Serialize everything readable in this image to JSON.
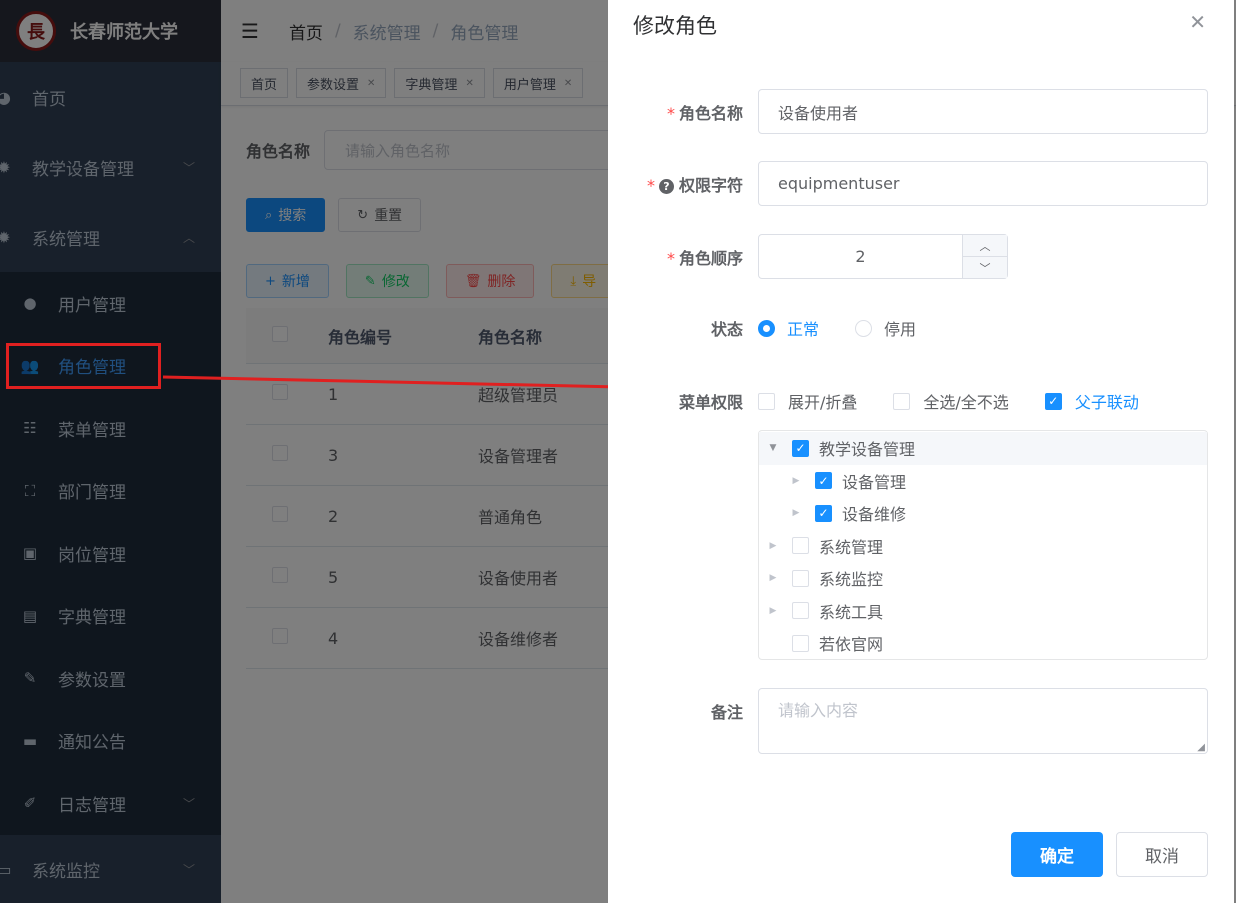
{
  "sidebar": {
    "logo_text": "长春师范大学",
    "logo_glyph": "長",
    "menus": [
      {
        "label": "首页",
        "icon": "dashboard-icon"
      },
      {
        "label": "教学设备管理",
        "icon": "gear-icon"
      },
      {
        "label": "系统管理",
        "icon": "gear-icon"
      }
    ],
    "sub_items": [
      {
        "label": "用户管理",
        "icon": "user-icon"
      },
      {
        "label": "角色管理",
        "icon": "peoples-icon"
      },
      {
        "label": "菜单管理",
        "icon": "tree-table-icon"
      },
      {
        "label": "部门管理",
        "icon": "tree-icon"
      },
      {
        "label": "岗位管理",
        "icon": "post-icon"
      },
      {
        "label": "字典管理",
        "icon": "dict-icon"
      },
      {
        "label": "参数设置",
        "icon": "edit-icon"
      },
      {
        "label": "通知公告",
        "icon": "message-icon"
      },
      {
        "label": "日志管理",
        "icon": "log-icon"
      }
    ],
    "bottom_menu": {
      "label": "系统监控",
      "icon": "monitor-icon"
    }
  },
  "breadcrumb": [
    "首页",
    "系统管理",
    "角色管理"
  ],
  "tags": [
    "首页",
    "参数设置",
    "字典管理",
    "用户管理"
  ],
  "query": {
    "label": "角色名称",
    "placeholder": "请输入角色名称",
    "search_btn": "搜索",
    "reset_btn": "重置"
  },
  "toolbar": {
    "add": "新增",
    "edit": "修改",
    "delete": "删除",
    "export": "导"
  },
  "table": {
    "headers": [
      "角色编号",
      "角色名称"
    ],
    "rows": [
      [
        "1",
        "超级管理员"
      ],
      [
        "3",
        "设备管理者"
      ],
      [
        "2",
        "普通角色"
      ],
      [
        "5",
        "设备使用者"
      ],
      [
        "4",
        "设备维修者"
      ]
    ]
  },
  "dialog": {
    "title": "修改角色",
    "role_name_label": "角色名称",
    "role_name_value": "设备使用者",
    "role_key_label": "权限字符",
    "role_key_value": "equipmentuser",
    "role_sort_label": "角色顺序",
    "role_sort_value": "2",
    "status_label": "状态",
    "status_normal": "正常",
    "status_disabled": "停用",
    "menu_label": "菜单权限",
    "expand_label": "展开/折叠",
    "select_all_label": "全选/全不选",
    "linkage_label": "父子联动",
    "tree": [
      {
        "label": "教学设备管理",
        "level": 0,
        "checked": true,
        "expanded": true
      },
      {
        "label": "设备管理",
        "level": 1,
        "checked": true
      },
      {
        "label": "设备维修",
        "level": 1,
        "checked": true
      },
      {
        "label": "系统管理",
        "level": 0,
        "checked": false
      },
      {
        "label": "系统监控",
        "level": 0,
        "checked": false
      },
      {
        "label": "系统工具",
        "level": 0,
        "checked": false
      },
      {
        "label": "若依官网",
        "level": 0,
        "checked": false
      }
    ],
    "remark_label": "备注",
    "remark_placeholder": "请输入内容",
    "ok_btn": "确定",
    "cancel_btn": "取消"
  },
  "colors": {
    "primary": "#1890ff",
    "sidebar_bg": "#304156",
    "annotation_red": "#e02020"
  }
}
